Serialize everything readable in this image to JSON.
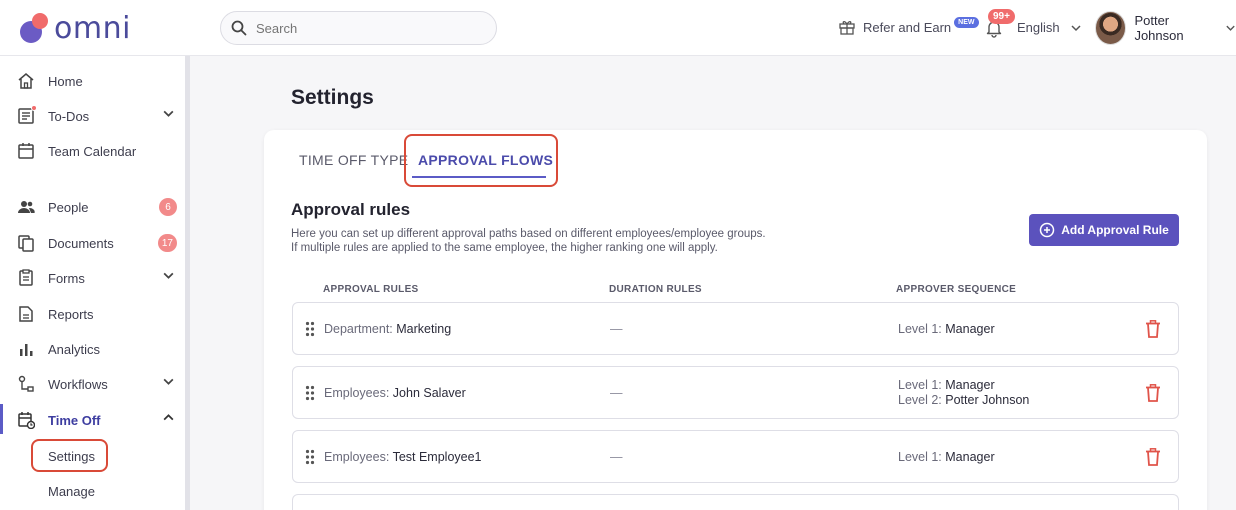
{
  "header": {
    "logo_text": "omni",
    "search_placeholder": "Search",
    "refer_label": "Refer and Earn",
    "new_badge": "NEW",
    "notif_count": "99+",
    "language": "English",
    "user_name": "Potter Johnson"
  },
  "sidebar": {
    "items": [
      {
        "label": "Home"
      },
      {
        "label": "To-Dos"
      },
      {
        "label": "Team Calendar"
      },
      {
        "label": "People",
        "badge": "6"
      },
      {
        "label": "Documents",
        "badge": "17"
      },
      {
        "label": "Forms"
      },
      {
        "label": "Reports"
      },
      {
        "label": "Analytics"
      },
      {
        "label": "Workflows"
      },
      {
        "label": "Time Off"
      }
    ],
    "sub_items": [
      {
        "label": "Settings"
      },
      {
        "label": "Manage"
      }
    ]
  },
  "main": {
    "title": "Settings",
    "tabs": [
      {
        "label": "TIME OFF TYPE"
      },
      {
        "label": "APPROVAL FLOWS"
      }
    ],
    "section_title": "Approval rules",
    "section_desc_1": "Here you can set up different approval paths based on different employees/employee groups.",
    "section_desc_2": "If multiple rules are applied to the same employee, the higher ranking one will apply.",
    "add_button": "Add Approval Rule",
    "columns": [
      "APPROVAL RULES",
      "DURATION RULES",
      "APPROVER SEQUENCE"
    ],
    "rows": [
      {
        "rule_key": "Department:",
        "rule_val": "Marketing",
        "duration": "—",
        "levels": [
          {
            "k": "Level 1:",
            "v": "Manager"
          }
        ]
      },
      {
        "rule_key": "Employees:",
        "rule_val": "John Salaver",
        "duration": "—",
        "levels": [
          {
            "k": "Level 1:",
            "v": "Manager"
          },
          {
            "k": "Level 2:",
            "v": "Potter Johnson"
          }
        ]
      },
      {
        "rule_key": "Employees:",
        "rule_val": "Test Employee1",
        "duration": "—",
        "levels": [
          {
            "k": "Level 1:",
            "v": "Manager"
          }
        ]
      }
    ]
  },
  "colors": {
    "accent": "#5b52bd",
    "highlight": "#d94a38",
    "badge": "#f28a8a",
    "trash": "#e0544a"
  }
}
